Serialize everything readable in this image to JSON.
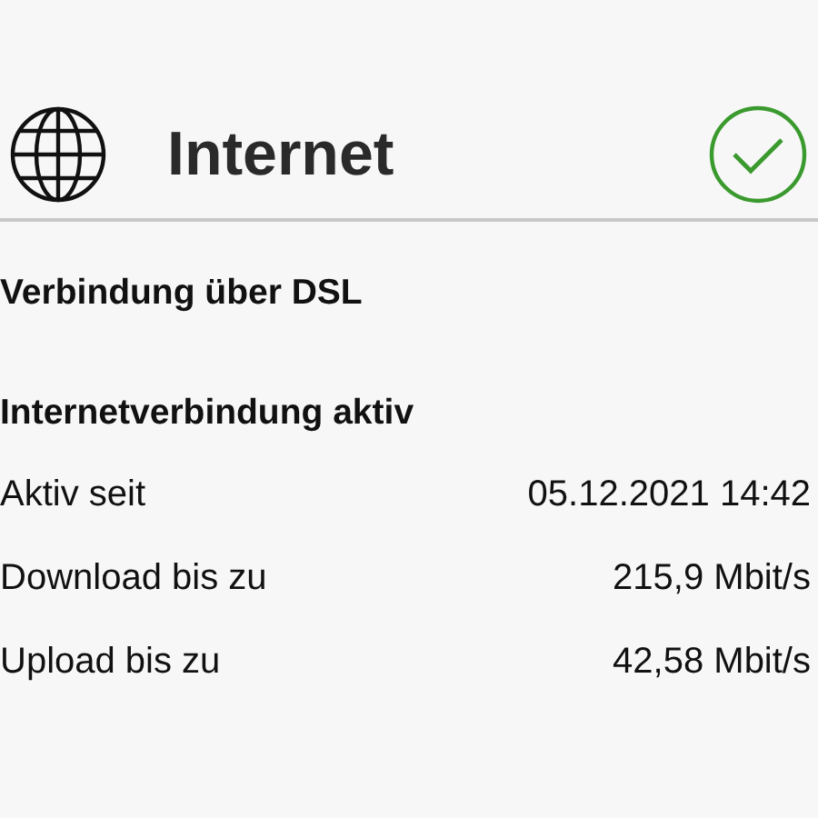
{
  "header": {
    "title": "Internet",
    "connected": true
  },
  "connection_type": "Verbindung über DSL",
  "status_heading": "Internetverbindung aktiv",
  "details": [
    {
      "label": "Aktiv seit",
      "value": "05.12.2021 14:42"
    },
    {
      "label": "Download bis zu",
      "value": "215,9 Mbit/s"
    },
    {
      "label": "Upload bis zu",
      "value": "42,58 Mbit/s"
    }
  ]
}
